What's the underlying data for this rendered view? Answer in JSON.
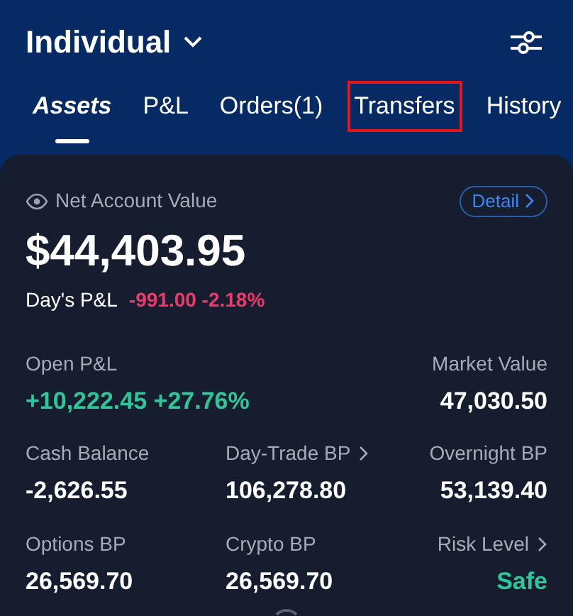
{
  "account": {
    "title": "Individual"
  },
  "tabs": [
    {
      "label": "Assets",
      "selected": true,
      "highlighted": false
    },
    {
      "label": "P&L",
      "selected": false,
      "highlighted": false
    },
    {
      "label": "Orders(1)",
      "selected": false,
      "highlighted": false
    },
    {
      "label": "Transfers",
      "selected": false,
      "highlighted": true
    },
    {
      "label": "History",
      "selected": false,
      "highlighted": false
    }
  ],
  "summary": {
    "label": "Net Account Value",
    "detail_button": "Detail",
    "value": "$44,403.95",
    "days_pl": {
      "label": "Day's P&L",
      "value": "-991.00 -2.18%",
      "color": "#f0386b"
    }
  },
  "metric_rows": [
    [
      {
        "label": "Open P&L",
        "value": "+10,222.45 +27.76%",
        "color": "#2ec79a",
        "link": false
      },
      {
        "label": "Market Value",
        "value": "47,030.50",
        "color": "#ffffff",
        "link": false
      }
    ],
    [
      {
        "label": "Cash Balance",
        "value": "-2,626.55",
        "color": "#ffffff",
        "link": false
      },
      {
        "label": "Day-Trade BP",
        "value": "106,278.80",
        "color": "#ffffff",
        "link": true
      },
      {
        "label": "Overnight BP",
        "value": "53,139.40",
        "color": "#ffffff",
        "link": false
      }
    ],
    [
      {
        "label": "Options BP",
        "value": "26,569.70",
        "color": "#ffffff",
        "link": false
      },
      {
        "label": "Crypto BP",
        "value": "26,569.70",
        "color": "#ffffff",
        "link": false
      },
      {
        "label": "Risk Level",
        "value": "Safe",
        "color": "#2ec79a",
        "link": true
      }
    ]
  ]
}
